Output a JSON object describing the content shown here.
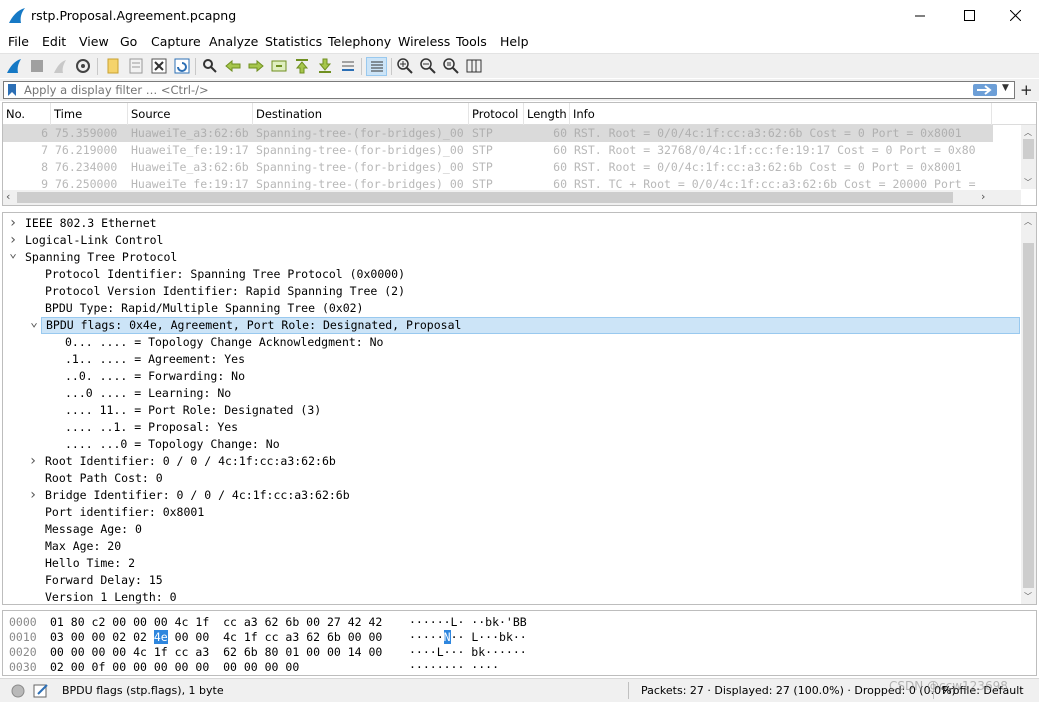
{
  "window": {
    "title": "rstp.Proposal.Agreement.pcapng"
  },
  "menu": [
    "File",
    "Edit",
    "View",
    "Go",
    "Capture",
    "Analyze",
    "Statistics",
    "Telephony",
    "Wireless",
    "Tools",
    "Help"
  ],
  "filter": {
    "placeholder": "Apply a display filter … <Ctrl-/>"
  },
  "packet_list": {
    "columns": [
      "No.",
      "Time",
      "Source",
      "Destination",
      "Protocol",
      "Length",
      "Info"
    ],
    "rows": [
      {
        "no": "6",
        "time": "75.359000",
        "source": "HuaweiTe_a3:62:6b",
        "destination": "Spanning-tree-(for-bridges)_00",
        "protocol": "STP",
        "length": "60",
        "info": "RST. Root = 0/0/4c:1f:cc:a3:62:6b  Cost = 0  Port = 0x8001",
        "selected": true
      },
      {
        "no": "7",
        "time": "76.219000",
        "source": "HuaweiTe_fe:19:17",
        "destination": "Spanning-tree-(for-bridges)_00",
        "protocol": "STP",
        "length": "60",
        "info": "RST. Root = 32768/0/4c:1f:cc:fe:19:17  Cost = 0  Port = 0x80",
        "selected": false
      },
      {
        "no": "8",
        "time": "76.234000",
        "source": "HuaweiTe_a3:62:6b",
        "destination": "Spanning-tree-(for-bridges)_00",
        "protocol": "STP",
        "length": "60",
        "info": "RST. Root = 0/0/4c:1f:cc:a3:62:6b  Cost = 0  Port = 0x8001",
        "selected": false
      },
      {
        "no": "9",
        "time": "76.250000",
        "source": "HuaweiTe_fe:19:17",
        "destination": "Spanning-tree-(for-bridges)_00",
        "protocol": "STP",
        "length": "60",
        "info": "RST. TC + Root = 0/0/4c:1f:cc:a3:62:6b  Cost = 20000  Port =",
        "selected": false
      }
    ]
  },
  "details": [
    {
      "text": "IEEE 802.3 Ethernet",
      "level": 0,
      "arrow": "collapsed"
    },
    {
      "text": "Logical-Link Control",
      "level": 0,
      "arrow": "collapsed"
    },
    {
      "text": "Spanning Tree Protocol",
      "level": 0,
      "arrow": "expanded"
    },
    {
      "text": "Protocol Identifier: Spanning Tree Protocol (0x0000)",
      "level": 1,
      "arrow": "none"
    },
    {
      "text": "Protocol Version Identifier: Rapid Spanning Tree (2)",
      "level": 1,
      "arrow": "none"
    },
    {
      "text": "BPDU Type: Rapid/Multiple Spanning Tree (0x02)",
      "level": 1,
      "arrow": "none"
    },
    {
      "text": "BPDU flags: 0x4e, Agreement, Port Role: Designated, Proposal",
      "level": 1,
      "arrow": "expanded",
      "highlight": true
    },
    {
      "text": "0... .... = Topology Change Acknowledgment: No",
      "level": 2,
      "arrow": "none"
    },
    {
      "text": ".1.. .... = Agreement: Yes",
      "level": 2,
      "arrow": "none"
    },
    {
      "text": "..0. .... = Forwarding: No",
      "level": 2,
      "arrow": "none"
    },
    {
      "text": "...0 .... = Learning: No",
      "level": 2,
      "arrow": "none"
    },
    {
      "text": ".... 11.. = Port Role: Designated (3)",
      "level": 2,
      "arrow": "none"
    },
    {
      "text": ".... ..1. = Proposal: Yes",
      "level": 2,
      "arrow": "none"
    },
    {
      "text": ".... ...0 = Topology Change: No",
      "level": 2,
      "arrow": "none"
    },
    {
      "text": "Root Identifier: 0 / 0 / 4c:1f:cc:a3:62:6b",
      "level": 1,
      "arrow": "collapsed"
    },
    {
      "text": "Root Path Cost: 0",
      "level": 1,
      "arrow": "none"
    },
    {
      "text": "Bridge Identifier: 0 / 0 / 4c:1f:cc:a3:62:6b",
      "level": 1,
      "arrow": "collapsed"
    },
    {
      "text": "Port identifier: 0x8001",
      "level": 1,
      "arrow": "none"
    },
    {
      "text": "Message Age: 0",
      "level": 1,
      "arrow": "none"
    },
    {
      "text": "Max Age: 20",
      "level": 1,
      "arrow": "none"
    },
    {
      "text": "Hello Time: 2",
      "level": 1,
      "arrow": "none"
    },
    {
      "text": "Forward Delay: 15",
      "level": 1,
      "arrow": "none"
    },
    {
      "text": "Version 1 Length: 0",
      "level": 1,
      "arrow": "none"
    }
  ],
  "bytes": [
    {
      "offset": "0000",
      "hex_pre": "01 80 c2 00 00 00 4c 1f  cc a3 62 6b 00 27 42 42",
      "hex_sel": "",
      "hex_post": "",
      "ascii_pre": "······L· ··bk·'BB",
      "ascii_sel": "",
      "ascii_post": ""
    },
    {
      "offset": "0010",
      "hex_pre": "03 00 00 02 02 ",
      "hex_sel": "4e",
      "hex_post": " 00 00  4c 1f cc a3 62 6b 00 00",
      "ascii_pre": "·····",
      "ascii_sel": "N",
      "ascii_post": "·· L···bk··"
    },
    {
      "offset": "0020",
      "hex_pre": "00 00 00 00 4c 1f cc a3  62 6b 80 01 00 00 14 00",
      "hex_sel": "",
      "hex_post": "",
      "ascii_pre": "····L··· bk······",
      "ascii_sel": "",
      "ascii_post": ""
    },
    {
      "offset": "0030",
      "hex_pre": "02 00 0f 00 00 00 00 00  00 00 00 00",
      "hex_sel": "",
      "hex_post": "",
      "ascii_pre": "········ ····",
      "ascii_sel": "",
      "ascii_post": ""
    }
  ],
  "status": {
    "field": "BPDU flags (stp.flags), 1 byte",
    "packets": "Packets: 27 · Displayed: 27 (100.0%) · Dropped: 0 (0.0%)",
    "profile": "Profile: Default",
    "watermark": "CSDN @ccw123698"
  }
}
